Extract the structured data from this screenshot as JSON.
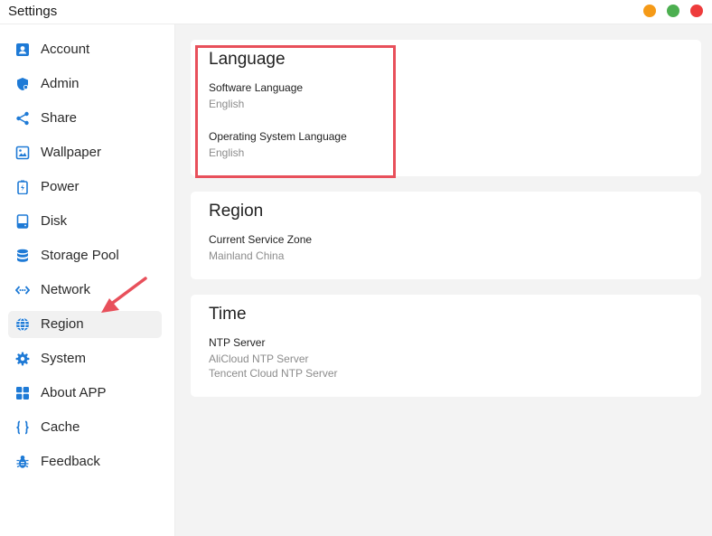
{
  "window": {
    "title": "Settings"
  },
  "colors": {
    "accent": "#1e7ad6",
    "highlight": "#e8505b",
    "min_btn": "#f59a17",
    "max_btn": "#4caf50",
    "close_btn": "#ee3b3b"
  },
  "sidebar": {
    "active": "Region",
    "items": [
      {
        "label": "Account",
        "icon": "account-icon"
      },
      {
        "label": "Admin",
        "icon": "shield-icon"
      },
      {
        "label": "Share",
        "icon": "share-icon"
      },
      {
        "label": "Wallpaper",
        "icon": "wallpaper-icon"
      },
      {
        "label": "Power",
        "icon": "battery-icon"
      },
      {
        "label": "Disk",
        "icon": "disk-icon"
      },
      {
        "label": "Storage Pool",
        "icon": "database-icon"
      },
      {
        "label": "Network",
        "icon": "network-icon"
      },
      {
        "label": "Region",
        "icon": "globe-icon"
      },
      {
        "label": "System",
        "icon": "gear-icon"
      },
      {
        "label": "About APP",
        "icon": "apps-icon"
      },
      {
        "label": "Cache",
        "icon": "braces-icon"
      },
      {
        "label": "Feedback",
        "icon": "bug-icon"
      }
    ]
  },
  "main": {
    "language": {
      "title": "Language",
      "software_label": "Software Language",
      "software_value": "English",
      "os_label": "Operating System Language",
      "os_value": "English"
    },
    "region": {
      "title": "Region",
      "zone_label": "Current Service Zone",
      "zone_value": "Mainland China"
    },
    "time": {
      "title": "Time",
      "ntp_label": "NTP Server",
      "ntp_values": [
        "AliCloud NTP Server",
        "Tencent Cloud NTP Server"
      ]
    }
  }
}
